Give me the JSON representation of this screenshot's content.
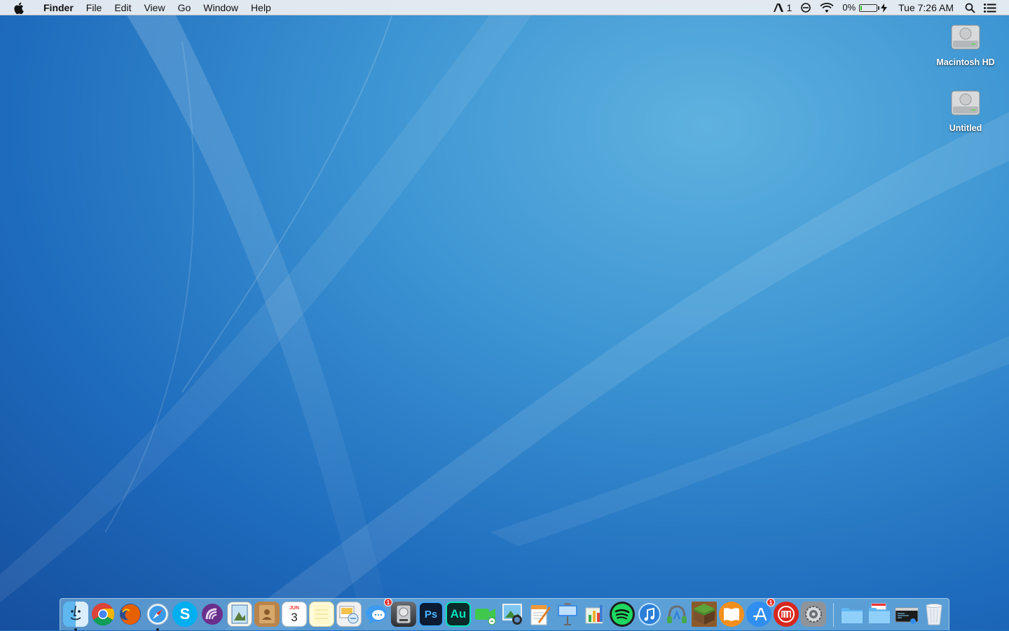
{
  "menubar": {
    "app_name": "Finder",
    "menus": [
      "File",
      "Edit",
      "View",
      "Go",
      "Window",
      "Help"
    ],
    "status": {
      "adobe_count": "1",
      "battery_percent": "0%",
      "battery_level": 0.04,
      "clock": "Tue 7:26 AM"
    }
  },
  "desktop": {
    "icons": [
      {
        "label": "Macintosh HD",
        "icon": "hard-drive-icon"
      },
      {
        "label": "Untitled",
        "icon": "hard-drive-icon"
      }
    ]
  },
  "dock": {
    "calendar": {
      "month": "JUN",
      "day": "3"
    },
    "photoshop_label": "Ps",
    "audition_label": "Au",
    "skype_label": "S",
    "messages_badge": "1",
    "appstore_badge": "1",
    "apps": [
      "finder-icon",
      "chrome-icon",
      "firefox-icon",
      "safari-icon",
      "skype-icon",
      "torrent-icon",
      "preview-icon",
      "contacts-icon",
      "calendar-icon",
      "notes-icon",
      "photo-viewer-icon",
      "messages-icon",
      "disk-utility-icon",
      "photoshop-icon",
      "audition-icon",
      "facetime-icon",
      "iphoto-icon",
      "pages-icon",
      "keynote-icon",
      "numbers-icon",
      "spotify-icon",
      "itunes-icon",
      "audio-app-icon",
      "minecraft-icon",
      "ibooks-icon",
      "app-store-icon",
      "maps-app-icon",
      "system-preferences-icon",
      "folder-icon",
      "downloads-folder-icon",
      "terminal-icon",
      "trash-icon"
    ]
  },
  "colors": {
    "menubar_bg": "#e8ecf1",
    "wallpaper_mid": "#3b93d2",
    "wallpaper_dark": "#164f9e"
  }
}
